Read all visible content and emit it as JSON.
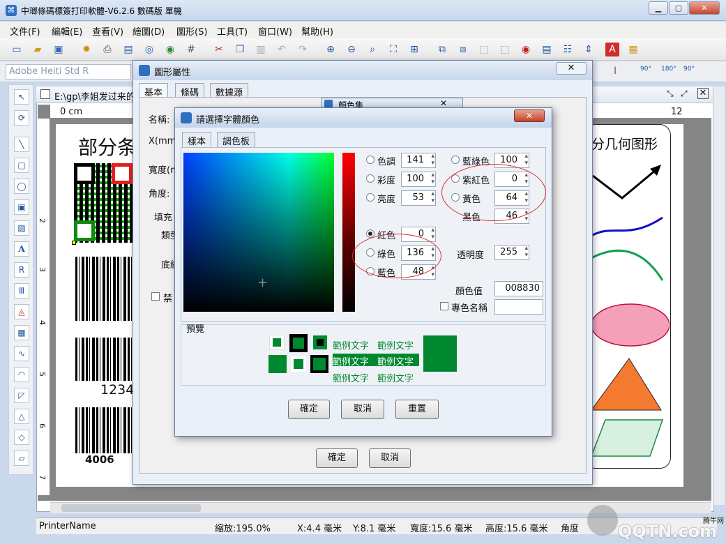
{
  "app": {
    "title": "中瑯條碼標簽打印軟體-V6.2.6 數碼版 單機",
    "controls": [
      "▁",
      "▢",
      "✕"
    ]
  },
  "menu": [
    "文件(F)",
    "編輯(E)",
    "查看(V)",
    "繪圖(D)",
    "圖形(S)",
    "工具(T)",
    "窗口(W)",
    "幫助(H)"
  ],
  "fontbar": {
    "font_name": "Adobe Heiti Std R",
    "rotations": [
      "90°",
      "180°",
      "90°"
    ]
  },
  "document": {
    "tab_title": "E:\\gp\\李姐发过来的",
    "ruler_marks": [
      "0 cm",
      "12"
    ],
    "vruler_marks": [
      "2",
      "3",
      "4",
      "5",
      "6",
      "7"
    ],
    "heading_left": "部分条",
    "heading_right": "分几何图形",
    "barcode_text_1": "1234",
    "barcode_text_2": "4006"
  },
  "status": {
    "printer": "PrinterName",
    "zoom": "縮放:195.0%",
    "x": "X:4.4 毫米",
    "y": "Y:8.1 毫米",
    "width": "寬度:15.6 毫米",
    "height": "高度:15.6 毫米",
    "angle": "角度"
  },
  "shape_props_dialog": {
    "title": "圖形屬性",
    "tabs": [
      "基本",
      "條碼",
      "數據源"
    ],
    "labels": {
      "name": "名稱:",
      "x": "X(mm)",
      "width": "寬度(m",
      "angle": "角度:",
      "fill": "填充",
      "type": "類型",
      "bottom": "底紋",
      "disable": "禁"
    },
    "ok": "確定",
    "cancel": "取消"
  },
  "color_set_dialog": {
    "title": "顏色集"
  },
  "font_color_dialog": {
    "title": "請選擇字體顏色",
    "tabs": [
      "樣本",
      "調色板"
    ],
    "hsb": {
      "hue_label": "色調",
      "hue": "141",
      "sat_label": "彩度",
      "sat": "100",
      "bri_label": "亮度",
      "bri": "53"
    },
    "rgb": {
      "red_label": "紅色",
      "red": "0",
      "green_label": "綠色",
      "green": "136",
      "blue_label": "藍色",
      "blue": "48"
    },
    "cmyk": {
      "cyan_label": "藍綠色",
      "cyan": "100",
      "magenta_label": "紫紅色",
      "magenta": "0",
      "yellow_label": "黃色",
      "yellow": "64",
      "black_label": "黑色",
      "black": "46"
    },
    "alpha_label": "透明度",
    "alpha": "255",
    "color_value_label": "顏色值",
    "color_value": "008830",
    "spot_label": "專色名稱",
    "preview_label": "預覽",
    "sample_text": "範例文字",
    "selected_color": "#008830",
    "ok": "確定",
    "cancel": "取消",
    "reset": "重置"
  },
  "watermark": {
    "brand_small": "腾牛网",
    "brand_large": "QQTN.com"
  }
}
